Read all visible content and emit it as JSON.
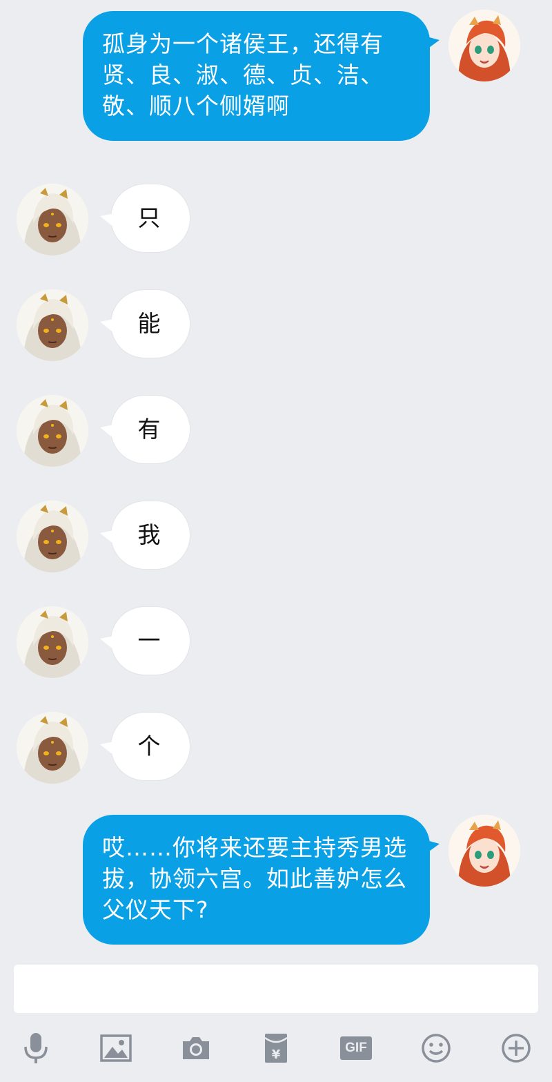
{
  "conversation": {
    "messages": [
      {
        "side": "right",
        "sender": "red-haired-character",
        "text": "孤身为一个诸侯王，还得有贤、良、淑、德、贞、洁、敬、顺八个侧婿啊"
      },
      {
        "side": "left",
        "sender": "white-haired-character",
        "text": "只"
      },
      {
        "side": "left",
        "sender": "white-haired-character",
        "text": "能"
      },
      {
        "side": "left",
        "sender": "white-haired-character",
        "text": "有"
      },
      {
        "side": "left",
        "sender": "white-haired-character",
        "text": "我"
      },
      {
        "side": "left",
        "sender": "white-haired-character",
        "text": "一"
      },
      {
        "side": "left",
        "sender": "white-haired-character",
        "text": "个"
      },
      {
        "side": "right",
        "sender": "red-haired-character",
        "text": "哎……你将来还要主持秀男选拔，协领六宫。如此善妒怎么父仪天下?"
      }
    ]
  },
  "composer": {
    "input_value": "",
    "tools": [
      "microphone-icon",
      "image-icon",
      "camera-icon",
      "red-packet-icon",
      "gif-icon",
      "emoji-icon",
      "plus-icon"
    ],
    "gif_label": "GIF"
  },
  "colors": {
    "background": "#ebedf1",
    "outgoing_bubble": "#0aa0e6",
    "incoming_bubble": "#ffffff",
    "icon": "#8a9099"
  }
}
